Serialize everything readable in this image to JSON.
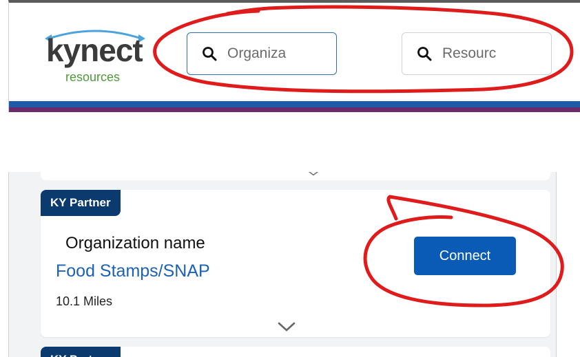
{
  "logo": {
    "wordmark": "kynect",
    "subtext": "resources",
    "arc_color": "#4aa3df",
    "wordmark_color": "#3b3b3b",
    "subtext_color": "#4e9a3a"
  },
  "header": {
    "organization_search": {
      "placeholder": "Organiza",
      "icon": "search-icon"
    },
    "resource_search": {
      "placeholder": "Resourc",
      "icon": "search-icon"
    },
    "bar_colors": [
      "#1f5aa8",
      "#6b2c6c"
    ]
  },
  "result_card": {
    "badge": "KY Partner",
    "organization_name": "Organization name",
    "program": "Food Stamps/SNAP",
    "distance": "10.1 Miles",
    "connect_label": "Connect",
    "expand_icon": "chevron-down-icon"
  },
  "next_card": {
    "badge": "KY Partner"
  },
  "colors": {
    "badge_bg": "#0b3a6e",
    "button_bg": "#0a5bb5",
    "link": "#1b61b6",
    "annotation": "#e01b1b"
  }
}
